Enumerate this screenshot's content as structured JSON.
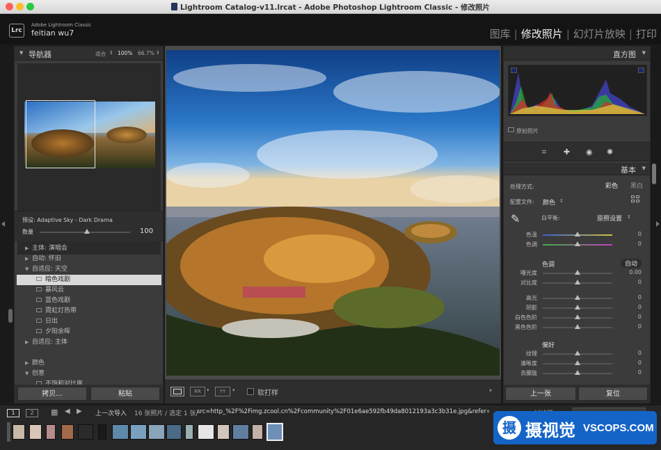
{
  "window": {
    "title": "Lightroom Catalog-v11.lrcat - Adobe Photoshop Lightroom Classic - 修改照片"
  },
  "identity": {
    "badge": "Lrc",
    "product": "Adobe Lightroom Classic",
    "user": "feitian wu7"
  },
  "modules": [
    {
      "label": "图库"
    },
    {
      "label": "修改照片",
      "active": true
    },
    {
      "label": "幻灯片放映"
    },
    {
      "label": "打印"
    }
  ],
  "navigator": {
    "title": "导航器",
    "fit": "适合",
    "zoom1": "100%",
    "zoom2": "66.7%"
  },
  "preset": {
    "label": "预设: Adaptive Sky - Dark Drama",
    "amount_label": "数量",
    "amount": "100",
    "amount_fraction": 0.52
  },
  "preset_tree": [
    {
      "label": "主体: 演唱会",
      "indent": 1,
      "twisty": "right"
    },
    {
      "label": "自动: 怀旧",
      "indent": 1,
      "twisty": "right"
    },
    {
      "label": "自适应: 天空",
      "indent": 1,
      "twisty": "down"
    },
    {
      "label": "暗色戏剧",
      "indent": 2,
      "selected": true
    },
    {
      "label": "暴风云",
      "indent": 2
    },
    {
      "label": "蓝色戏剧",
      "indent": 2
    },
    {
      "label": "霓虹灯热带",
      "indent": 2
    },
    {
      "label": "日出",
      "indent": 2
    },
    {
      "label": "夕阳余晖",
      "indent": 2
    },
    {
      "label": "自适应: 主体",
      "indent": 1,
      "twisty": "right"
    },
    {
      "label": "",
      "indent": 1
    },
    {
      "label": "颜色",
      "indent": 1,
      "twisty": "right"
    },
    {
      "label": "创意",
      "indent": 1,
      "twisty": "down"
    },
    {
      "label": "不饱和对比度",
      "indent": 2
    }
  ],
  "left_buttons": {
    "copy": "拷贝...",
    "paste": "粘贴"
  },
  "center_toolbar": {
    "soft_proof": "软打样"
  },
  "histogram": {
    "title": "直方图",
    "original": "原始照片"
  },
  "basic": {
    "title": "基本",
    "treatment_label": "处理方式:",
    "treatment_color": "彩色",
    "treatment_bw": "黑白",
    "profile_label": "配置文件:",
    "profile_value": "颜色",
    "wb_label": "白平衡:",
    "wb_value": "原照设置",
    "tone_header": "色调",
    "auto": "自动",
    "presence_header": "偏好",
    "sliders": [
      {
        "label": "色温",
        "value": "0",
        "pos": 0.5,
        "group": "wb"
      },
      {
        "label": "色调",
        "value": "0",
        "pos": 0.5,
        "group": "wb"
      },
      {
        "label": "曝光度",
        "value": "0.00",
        "pos": 0.5,
        "group": "tone"
      },
      {
        "label": "对比度",
        "value": "0",
        "pos": 0.5,
        "group": "tone"
      },
      {
        "label": "高光",
        "value": "0",
        "pos": 0.5,
        "group": "tone2"
      },
      {
        "label": "阴影",
        "value": "0",
        "pos": 0.5,
        "group": "tone2"
      },
      {
        "label": "白色色阶",
        "value": "0",
        "pos": 0.5,
        "group": "tone2"
      },
      {
        "label": "黑色色阶",
        "value": "0",
        "pos": 0.5,
        "group": "tone2"
      },
      {
        "label": "纹理",
        "value": "0",
        "pos": 0.5,
        "group": "presence"
      },
      {
        "label": "清晰度",
        "value": "0",
        "pos": 0.5,
        "group": "presence"
      },
      {
        "label": "去朦胧",
        "value": "0",
        "pos": 0.5,
        "group": "presence"
      }
    ]
  },
  "right_buttons": {
    "prev": "上一张",
    "reset": "复位"
  },
  "filmstrip": {
    "view1": "1",
    "view2": "2",
    "source": "上一次导入",
    "count": "16 张照片 / 选定 1 张/",
    "filename": "src=http_%2F%2Fimg.zcool.cn%2Fcommunity%2F01e6ae592fb49da8012193a3c3b31e.jpg&refer=http_%2F%",
    "filter_label": "过滤器"
  },
  "watermark": {
    "text": "摄视觉",
    "site": "VSCOPS.COM"
  }
}
